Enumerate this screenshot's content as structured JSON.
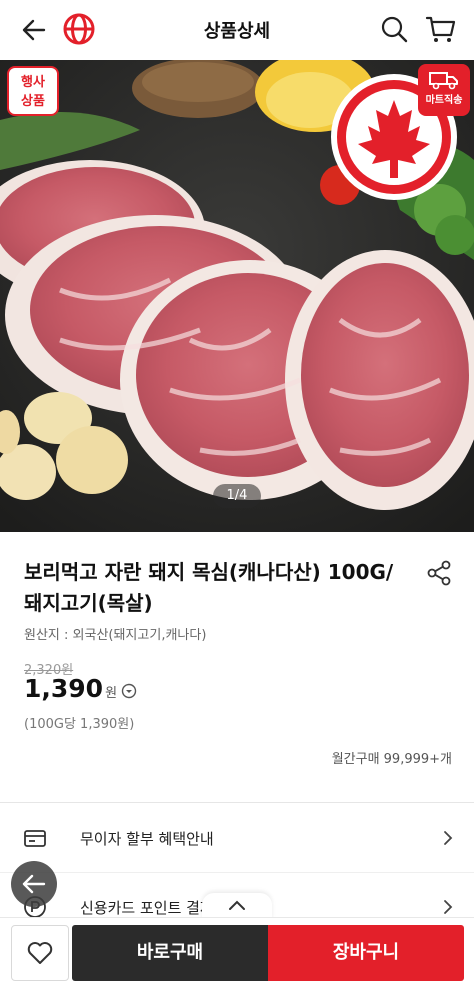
{
  "header": {
    "title": "상품상세"
  },
  "hero": {
    "event_badge_line1": "행사",
    "event_badge_line2": "상품",
    "direct_badge": "마트직송",
    "page_indicator": "1/4"
  },
  "product": {
    "title": "보리먹고 자란 돼지 목심(캐나다산) 100G/돼지고기(목살)",
    "origin": "원산지 : 외국산(돼지고기,캐나다)",
    "original_price": "2,320원",
    "price": "1,390",
    "currency": "원",
    "unit_price": "(100G당 1,390원)",
    "monthly_purchase": "월간구매 99,999+개"
  },
  "benefits": {
    "installment_label": "무이자 할부 혜택안내",
    "card_point_label": "신용카드 포인트 결제"
  },
  "bottom_bar": {
    "buy_now_label": "바로구매",
    "add_to_cart_label": "장바구니"
  },
  "colors": {
    "brand_red": "#e3202a",
    "buy_button": "#2b2b2b"
  },
  "icons": [
    "back-arrow-icon",
    "brand-logo-icon",
    "search-icon",
    "cart-icon",
    "share-icon",
    "info-circle-icon",
    "card-icon",
    "point-icon",
    "chevron-right-icon",
    "chevron-up-icon",
    "heart-icon",
    "truck-icon",
    "maple-leaf-icon"
  ]
}
